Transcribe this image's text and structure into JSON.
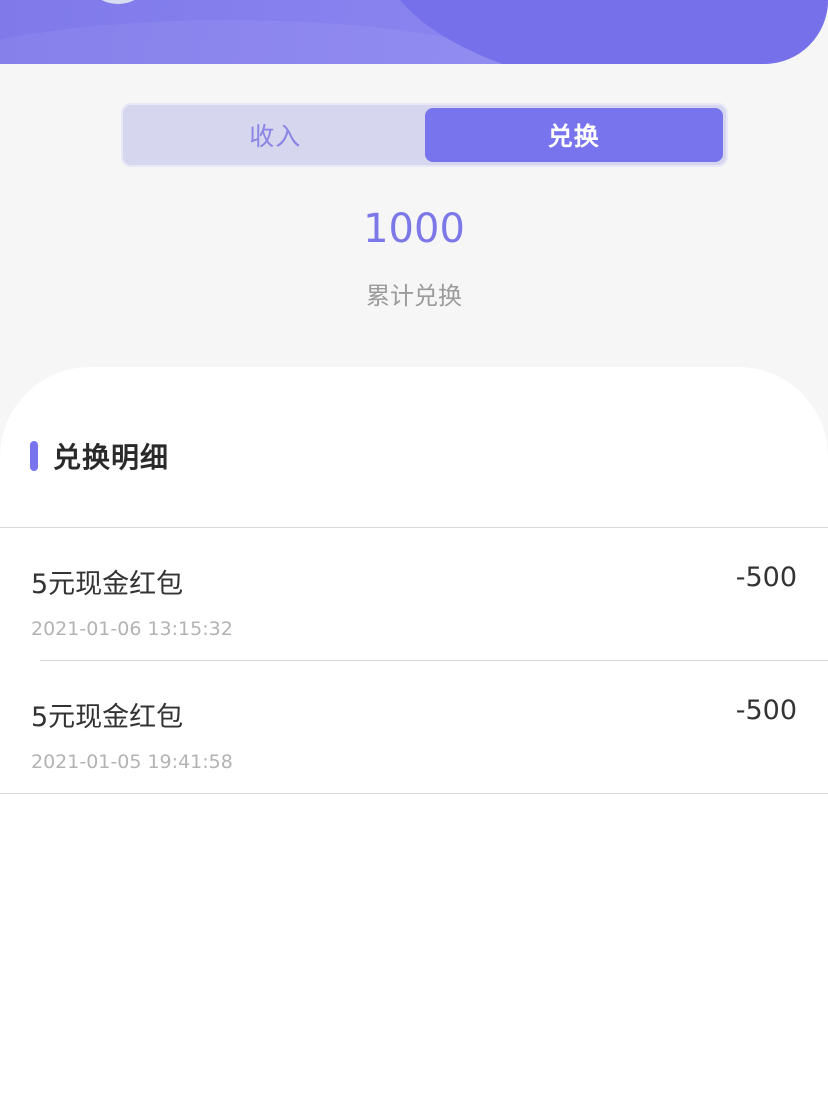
{
  "tabs": {
    "income_label": "收入",
    "exchange_label": "兑换",
    "active": "兑换"
  },
  "summary": {
    "value": "1000",
    "label": "累计兑换"
  },
  "detail": {
    "title": "兑换明细",
    "records": [
      {
        "title": "5元现金红包",
        "time": "2021-01-06 13:15:32",
        "amount": "-500"
      },
      {
        "title": "5元现金红包",
        "time": "2021-01-05 19:41:58",
        "amount": "-500"
      }
    ]
  },
  "colors": {
    "accent": "#7774ee",
    "accent_text": "#7c78e8",
    "tab_track": "#d6d6ee"
  }
}
